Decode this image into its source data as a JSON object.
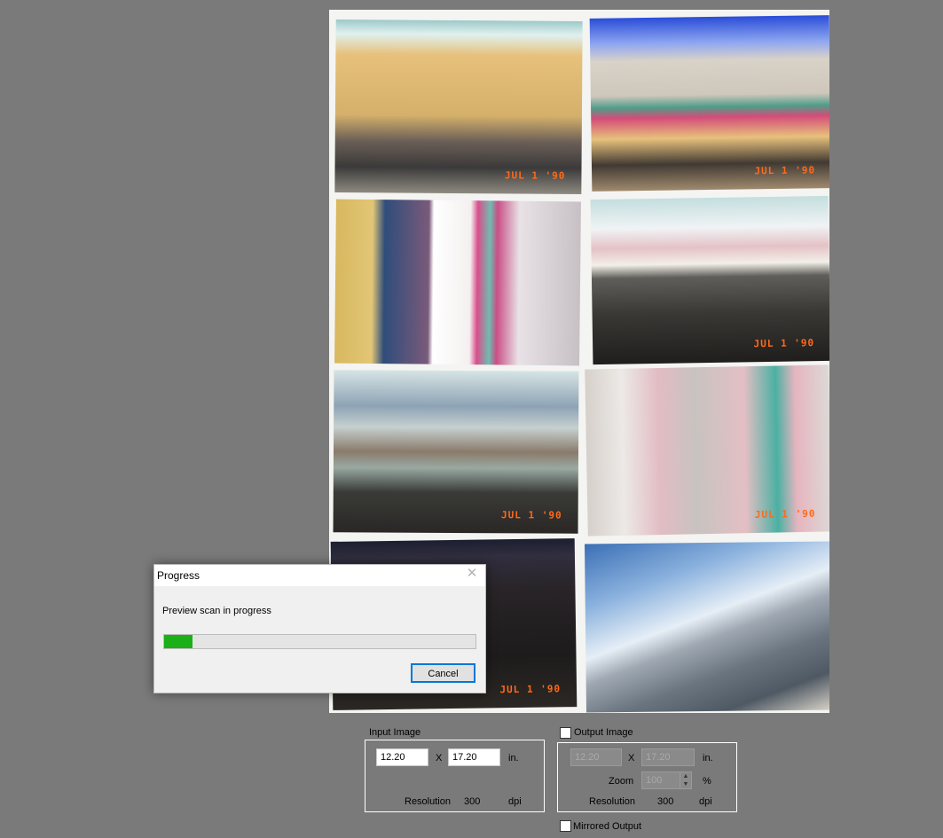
{
  "preview": {
    "photos": [
      {
        "stamp": "JUL 1 '90"
      },
      {
        "stamp": "JUL 1 '90"
      },
      {
        "stamp": ""
      },
      {
        "stamp": "JUL 1 '90"
      },
      {
        "stamp": "JUL 1 '90"
      },
      {
        "stamp": "JUL 1 '90"
      },
      {
        "stamp": "JUL 1 '90"
      },
      {
        "stamp": ""
      }
    ]
  },
  "dialog": {
    "title": "Progress",
    "close_glyph": "✕",
    "message": "Preview scan in progress",
    "progress_fraction": 0.09,
    "progress_color": "#1bb017",
    "cancel_label": "Cancel"
  },
  "input_image": {
    "caption": "Input Image",
    "width": "12.20",
    "x_label": "X",
    "height": "17.20",
    "unit": "in.",
    "resolution_label": "Resolution",
    "resolution_value": "300",
    "resolution_unit": "dpi"
  },
  "output_image": {
    "caption": "Output Image",
    "checked": false,
    "width": "12.20",
    "x_label": "X",
    "height": "17.20",
    "unit": "in.",
    "zoom_label": "Zoom",
    "zoom_value": "100",
    "zoom_unit": "%",
    "resolution_label": "Resolution",
    "resolution_value": "300",
    "resolution_unit": "dpi"
  },
  "mirrored_output": {
    "label": "Mirrored Output",
    "checked": false
  }
}
